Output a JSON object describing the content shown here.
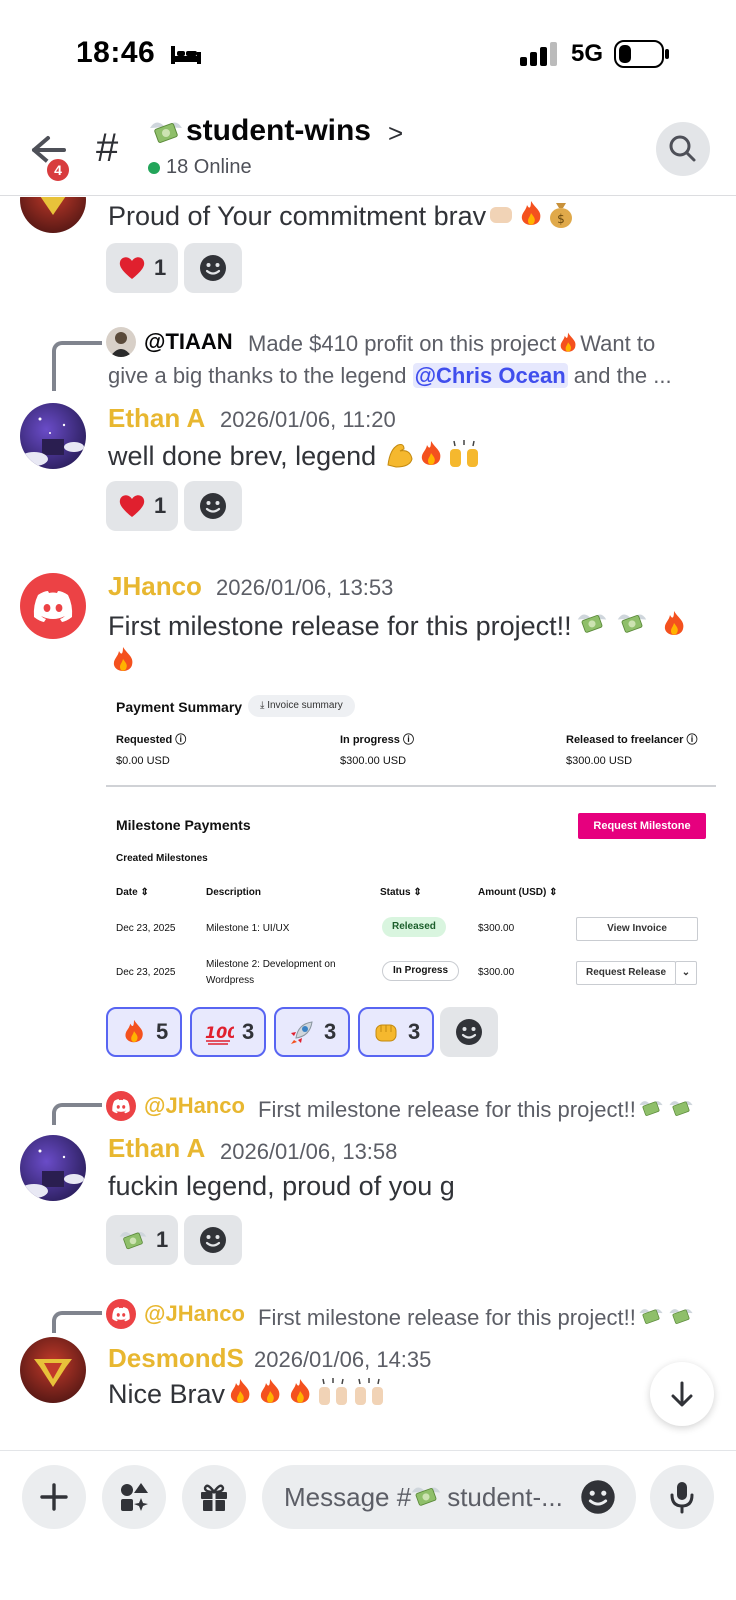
{
  "status_bar": {
    "time": "18:46",
    "network": "5G"
  },
  "header": {
    "back_badge": "4",
    "hash": "#",
    "channel_name": "student-wins",
    "chevron": ">",
    "online": "18 Online"
  },
  "messages": [
    {
      "text": "Proud of Your commitment brav",
      "reactions": [
        {
          "emoji": "heart",
          "count": "1"
        }
      ]
    },
    {
      "reply_user": "@TIAAN",
      "reply_text_1": "Made $410 profit on this project",
      "reply_text_2": "Want to",
      "reply_text_3": "give a big thanks to the legend",
      "reply_mention": "@Chris Ocean",
      "reply_text_4": "and the ...",
      "author": "Ethan A",
      "timestamp": "2026/01/06, 11:20",
      "text": "well done brev, legend",
      "reactions": [
        {
          "emoji": "heart",
          "count": "1"
        }
      ]
    },
    {
      "author": "JHanco",
      "timestamp": "2026/01/06, 13:53",
      "text": "First milestone release for this project!!",
      "reactions": [
        {
          "emoji": "fire",
          "count": "5"
        },
        {
          "emoji": "100",
          "count": "3"
        },
        {
          "emoji": "rocket",
          "count": "3"
        },
        {
          "emoji": "fist",
          "count": "3"
        }
      ]
    },
    {
      "reply_user": "@JHanco",
      "reply_text": "First milestone release for this project!!",
      "author": "Ethan A",
      "timestamp": "2026/01/06, 13:58",
      "text": "fuckin legend, proud of you g",
      "reactions": [
        {
          "emoji": "money-wings",
          "count": "1"
        }
      ]
    },
    {
      "reply_user": "@JHanco",
      "reply_text": "First milestone release for this project!!",
      "author": "DesmondS",
      "timestamp": "2026/01/06, 14:35",
      "text": "Nice Brav"
    }
  ],
  "payment_summary": {
    "title": "Payment Summary",
    "invoice_chip": "Invoice summary",
    "requested_label": "Requested",
    "requested_value": "$0.00 USD",
    "in_progress_label": "In progress",
    "in_progress_value": "$300.00 USD",
    "released_label": "Released to freelancer",
    "released_value": "$300.00 USD",
    "milestones_title": "Milestone Payments",
    "request_button": "Request Milestone",
    "created_title": "Created Milestones",
    "col_date": "Date",
    "col_description": "Description",
    "col_status": "Status",
    "col_amount": "Amount (USD)",
    "rows": [
      {
        "date": "Dec 23, 2025",
        "description": "Milestone 1: UI/UX",
        "status": "Released",
        "amount": "$300.00",
        "action": "View Invoice"
      },
      {
        "date": "Dec 23, 2025",
        "description_1": "Milestone 2: Development on",
        "description_2": "Wordpress",
        "status": "In Progress",
        "amount": "$300.00",
        "action": "Request Release"
      }
    ]
  },
  "composer": {
    "placeholder_prefix": "Message #",
    "placeholder_suffix": "student-..."
  },
  "colors": {
    "author": "#e8b730",
    "accent": "#5865f2",
    "mention_bg": "#e6e8fd",
    "pink": "#e6007e",
    "online": "#23a55a"
  }
}
